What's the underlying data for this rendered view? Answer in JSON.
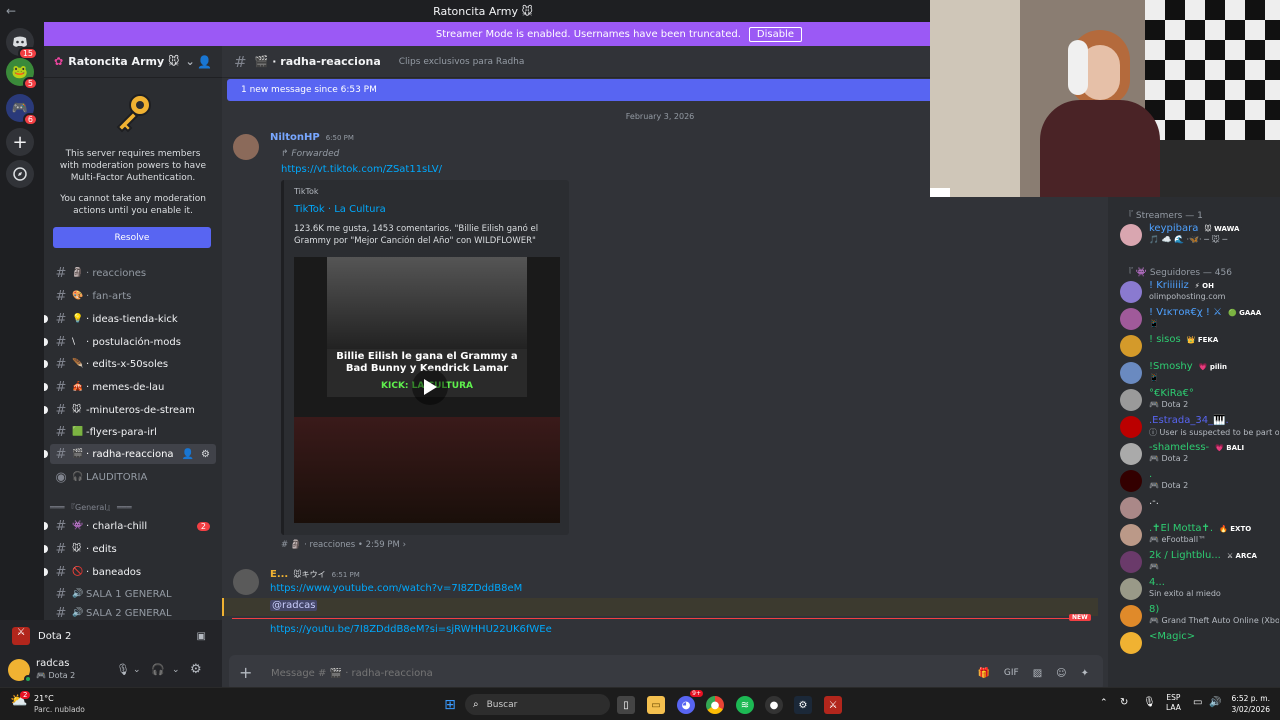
{
  "window": {
    "title": "Ratoncita Army 🐭",
    "back": "←",
    "forward": "→"
  },
  "banner": {
    "text": "Streamer Mode is enabled. Usernames have been truncated.",
    "button": "Disable"
  },
  "guilds": [
    {
      "badge": "15"
    },
    {
      "badge": "5"
    },
    {
      "badge": "6"
    }
  ],
  "server": {
    "name": "Ratoncita Army 🐭",
    "mfa_text": "This server requires members with moderation powers to have Multi-Factor Authentication.",
    "mfa_text2": "You cannot take any moderation actions until you enable it.",
    "resolve": "Resolve"
  },
  "channels": [
    {
      "name": "· reacciones",
      "emoji": "🗿"
    },
    {
      "name": "· fan-arts",
      "emoji": "🎨"
    },
    {
      "name": "· ideas-tienda-kick",
      "emoji": "💡"
    },
    {
      "name": "· postulación-mods",
      "emoji": "\\"
    },
    {
      "name": "· edits-x-50soles",
      "emoji": "🪶"
    },
    {
      "name": "· memes-de-lau",
      "emoji": "🎪"
    },
    {
      "name": "-minuteros-de-stream",
      "emoji": "🐭"
    },
    {
      "name": "-flyers-para-irl",
      "emoji": "🟩"
    },
    {
      "name": "· radha-reacciona",
      "emoji": "🎬"
    },
    {
      "name": "LAUDITORIA",
      "emoji": "🎧"
    }
  ],
  "category_general": "═══ 『General』 ═══",
  "channels2": [
    {
      "name": "· charla-chill",
      "emoji": "👾",
      "badge": "2"
    },
    {
      "name": "· edits",
      "emoji": "🐭"
    },
    {
      "name": "· baneados",
      "emoji": "🚫"
    },
    {
      "name": "SALA 1 GENERAL",
      "emoji": "🔊"
    },
    {
      "name": "SALA 2 GENERAL",
      "emoji": "🔊"
    }
  ],
  "voice": {
    "game": "Dota 2"
  },
  "user": {
    "name": "radcas",
    "status": "Dota 2"
  },
  "channel_header": {
    "name": "· radha-reacciona",
    "topic": "Clips exclusivos para Radha"
  },
  "new_messages": "1 new message since 6:53 PM",
  "date_divider": "February 3, 2026",
  "msg1": {
    "author": "NiltonHP",
    "time": "6:50 PM",
    "forwarded": "Forwarded",
    "link": "https://vt.tiktok.com/ZSat11sLV/",
    "embed_provider": "TikTok",
    "embed_title": "TikTok · La Cultura",
    "embed_desc": "123.6K me gusta, 1453 comentarios. \"Billie Eilish ganó el Grammy por \"Mejor Canción del Año\" con WILDFLOWER\"",
    "video_caption": "Billie Eilish le gana el Grammy a Bad Bunny y Kendrick Lamar",
    "video_kick": "KICK: LA CULTURA",
    "footer": "# 🗿 · reacciones • 2:59 PM ›"
  },
  "msg2": {
    "author": "E...",
    "tag": "🐭キウイ",
    "time": "6:51 PM",
    "link1": "https://www.youtube.com/watch?v=7I8ZDddB8eM",
    "mention": "@radcas",
    "link2": "https://youtu.be/7I8ZDddB8eM?si=sjRWHHU22UK6fWEe",
    "new_label": "NEW"
  },
  "input": {
    "placeholder": "Message # 🎬 · radha-reacciona"
  },
  "members": {
    "section1": "『 Streamers — 1",
    "streamers": [
      {
        "name": "keypibara",
        "tag": "🐭 WAWA",
        "status": "🎵 ☁️ 🌊 ·🦋· ─ 🐭 ─",
        "color": "#4ea1ff"
      }
    ],
    "section2": "『 👾 Seguidores — 456",
    "followers": [
      {
        "name": "! Kriiiiiiz",
        "tag": "⚡ OH",
        "status": "olimpohosting.com",
        "color": "#4ea1ff"
      },
      {
        "name": "! Vɪᴋᴛᴏʀ€χ ! ⚔",
        "tag": "🟢 GAAA",
        "status": "📱",
        "color": "#4ea1ff"
      },
      {
        "name": "! sisos",
        "tag": "👑 FEKA",
        "status": "",
        "color": "#2ecc71"
      },
      {
        "name": "!Smoshy",
        "tag": "💗 pilin",
        "status": "📱",
        "color": "#2ecc71"
      },
      {
        "name": "°€KiRa€°",
        "tag": "",
        "status": "🎮 Dota 2",
        "color": "#2ecc71"
      },
      {
        "name": ".Estrada_34_🎹.",
        "tag": "",
        "status": "ⓘ User is suspected to be part of ...",
        "color": "#5865f2"
      },
      {
        "name": "-shameless-",
        "tag": "💗 BALI",
        "status": "🎮 Dota 2",
        "color": "#2ecc71"
      },
      {
        "name": ".",
        "tag": "",
        "status": "🎮 Dota 2",
        "color": "#2ecc71"
      },
      {
        "name": ".-.",
        "tag": "",
        "status": "",
        "color": "#dbdee1"
      },
      {
        "name": ".✝El Motta✝.",
        "tag": "🔥 EXTO",
        "status": "🎮 eFootball™",
        "color": "#2ecc71"
      },
      {
        "name": "2k / Lightblu...",
        "tag": "⚔ ARCA",
        "status": "🎮",
        "color": "#2ecc71"
      },
      {
        "name": "4...",
        "tag": "",
        "status": "Sin exito al miedo",
        "color": "#2ecc71"
      },
      {
        "name": "8)",
        "tag": "",
        "status": "🎮 Grand Theft Auto Online (Xbox Se",
        "color": "#2ecc71"
      },
      {
        "name": "<Magic>",
        "tag": "",
        "status": "",
        "color": "#2ecc71"
      }
    ]
  },
  "taskbar": {
    "weather_temp": "21°C",
    "weather_desc": "Parc. nublado",
    "weather_badge": "2",
    "search": "Buscar",
    "lang1": "ESP",
    "lang2": "LAA",
    "time": "6:52 p. m.",
    "date": "3/02/2026",
    "discord_badge": "9+"
  }
}
